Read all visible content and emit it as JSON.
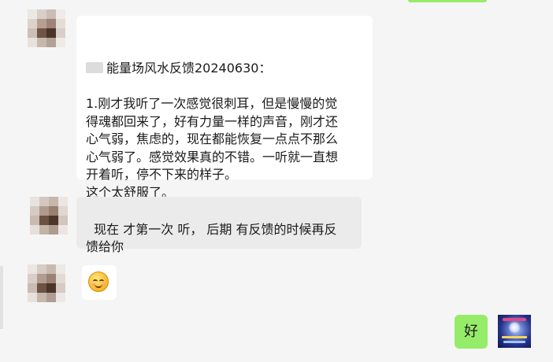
{
  "messages": [
    {
      "sender": "other",
      "bubble": "white",
      "title_line": "能量场风水反馈20240630：",
      "body": "\n1.刚才我听了一次感觉很刺耳，但是慢慢的觉\n得魂都回来了，好有力量一样的声音，刚才还\n心气弱，焦虑的，现在都能恢复一点点不那么\n心气弱了。感觉效果真的不错。一听就一直想\n开着听，停不下来的样子。\n这个太舒服了。"
    },
    {
      "sender": "other",
      "bubble": "grey",
      "text": "现在 才第一次 听， 后期 有反馈的时候再反\n馈给你"
    },
    {
      "sender": "other",
      "bubble": "white",
      "emoji": "smiling-face-emoji"
    },
    {
      "sender": "self",
      "bubble": "green",
      "text": "好"
    }
  ],
  "colors": {
    "background": "#f5f5f5",
    "incoming_bubble": "#ffffff",
    "incoming_bubble_alt": "#ebebeb",
    "outgoing_bubble": "#95ec69"
  }
}
